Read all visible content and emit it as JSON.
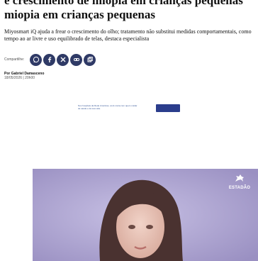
{
  "article": {
    "headline_top": "e crescimento de miopia em crianças pequenas",
    "headline_main": "miopia em crianças pequenas",
    "subtitle": "Miyosmart iQ ajuda a frear o crescimento do olho; tratamento não substitui medidas comportamentais, como tempo ao ar livre e uso equilibrado de telas, destaca especialista",
    "share_label": "Compartilhe:",
    "author": "Por Gabriel Damasceno",
    "date": "18/05/2026 | 20h00"
  },
  "share_icons": [
    "whatsapp-icon",
    "facebook-icon",
    "x-icon",
    "link-icon",
    "copy-icon"
  ],
  "ad": {
    "text": "Nos hospitais da Rede Américas, você conta com quem cuidar de saúde e da sua vida."
  },
  "video": {
    "brand": "ESTADÃO"
  },
  "colors": {
    "share_button": "#2f3a66",
    "video_bg": "#a79fc8",
    "ad_logo": "#2b3d8c"
  }
}
